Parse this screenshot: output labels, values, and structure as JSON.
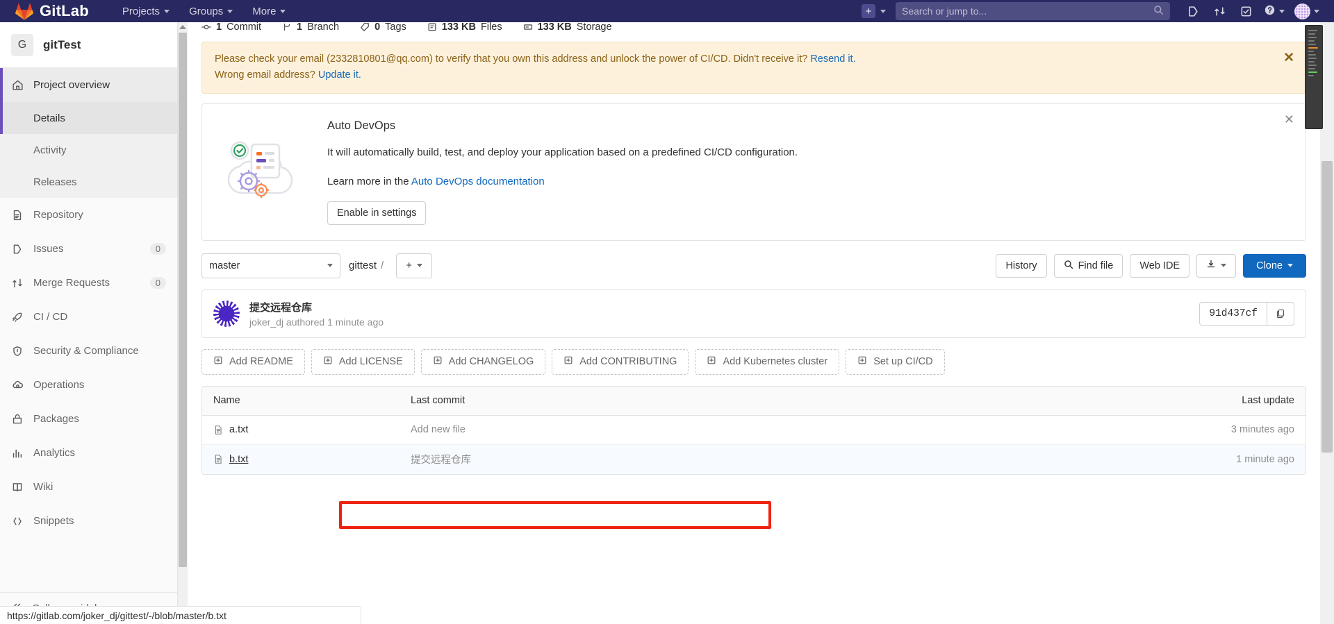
{
  "topnav": {
    "brand": "GitLab",
    "links": [
      {
        "label": "Projects",
        "icon": "chevron-down-icon"
      },
      {
        "label": "Groups",
        "icon": "chevron-down-icon"
      },
      {
        "label": "More",
        "icon": "chevron-down-icon"
      }
    ],
    "plus_label": "+",
    "search_placeholder": "Search or jump to...",
    "icons": [
      {
        "name": "issues-icon"
      },
      {
        "name": "merge-requests-icon"
      },
      {
        "name": "todos-icon"
      },
      {
        "name": "help-icon"
      },
      {
        "name": "user-avatar"
      }
    ]
  },
  "sidebar": {
    "project_initial": "G",
    "project_name": "gitTest",
    "overview": {
      "label": "Project overview",
      "icon": "home-icon"
    },
    "sub_items": [
      {
        "label": "Details",
        "current": true
      },
      {
        "label": "Activity",
        "current": false
      },
      {
        "label": "Releases",
        "current": false
      }
    ],
    "items": [
      {
        "label": "Repository",
        "icon": "document-icon",
        "badge": ""
      },
      {
        "label": "Issues",
        "icon": "issues-icon",
        "badge": "0"
      },
      {
        "label": "Merge Requests",
        "icon": "merge-requests-icon",
        "badge": "0"
      },
      {
        "label": "CI / CD",
        "icon": "rocket-icon",
        "badge": ""
      },
      {
        "label": "Security & Compliance",
        "icon": "shield-icon",
        "badge": ""
      },
      {
        "label": "Operations",
        "icon": "cloud-gear-icon",
        "badge": ""
      },
      {
        "label": "Packages",
        "icon": "package-icon",
        "badge": ""
      },
      {
        "label": "Analytics",
        "icon": "chart-icon",
        "badge": ""
      },
      {
        "label": "Wiki",
        "icon": "book-icon",
        "badge": ""
      },
      {
        "label": "Snippets",
        "icon": "snippet-icon",
        "badge": ""
      }
    ],
    "collapse_label": "Collapse sidebar"
  },
  "stats": [
    {
      "value": "1",
      "label": "Commit",
      "icon": "commit-icon"
    },
    {
      "value": "1",
      "label": "Branch",
      "icon": "branch-icon"
    },
    {
      "value": "0",
      "label": "Tags",
      "icon": "tag-icon"
    },
    {
      "value": "133 KB",
      "label": "Files",
      "icon": "files-icon"
    },
    {
      "value": "133 KB",
      "label": "Storage",
      "icon": "storage-icon"
    }
  ],
  "banner": {
    "text_before_email": "Please check your email (",
    "email": "2332810801@qq.com",
    "text_after_email": ") to verify that you own this address and unlock the power of CI/CD. Didn't receive it? ",
    "resend_link": "Resend it.",
    "line2_prefix": "Wrong email address? ",
    "update_link": "Update it.",
    "close_icon": "close-icon"
  },
  "auto_devops": {
    "title": "Auto DevOps",
    "description": "It will automatically build, test, and deploy your application based on a predefined CI/CD configuration.",
    "learn_prefix": "Learn more in the ",
    "learn_link": "Auto DevOps documentation",
    "button": "Enable in settings",
    "close_icon": "close-icon"
  },
  "toolbar": {
    "branch": "master",
    "breadcrumb_project": "gittest",
    "breadcrumb_sep": "/",
    "add_button": "+",
    "history": "History",
    "find_file": "Find file",
    "web_ide": "Web IDE",
    "download_icon": "download-icon",
    "clone": "Clone"
  },
  "commit": {
    "title": "提交远程仓库",
    "author": "joker_dj",
    "meta": "authored 1 minute ago",
    "sha": "91d437cf",
    "copy_icon": "copy-icon"
  },
  "add_buttons": [
    {
      "label": "Add README"
    },
    {
      "label": "Add LICENSE"
    },
    {
      "label": "Add CHANGELOG"
    },
    {
      "label": "Add CONTRIBUTING"
    },
    {
      "label": "Add Kubernetes cluster"
    },
    {
      "label": "Set up CI/CD"
    }
  ],
  "files": {
    "headers": {
      "name": "Name",
      "last_commit": "Last commit",
      "last_update": "Last update"
    },
    "rows": [
      {
        "name": "a.txt",
        "last_commit": "Add new file",
        "last_update": "3 minutes ago",
        "highlighted": false
      },
      {
        "name": "b.txt",
        "last_commit": "提交远程仓库",
        "last_update": "1 minute ago",
        "highlighted": true
      }
    ]
  },
  "status_bar": {
    "url": "https://gitlab.com/joker_dj/gittest/-/blob/master/b.txt"
  },
  "colors": {
    "nav_bg": "#292961",
    "accent_purple": "#6b4fbb",
    "primary_blue": "#1068bf",
    "link_blue": "#1b69b6",
    "banner_bg": "#fdf1dc",
    "banner_text": "#8a6116",
    "highlight_red": "#ee2211"
  }
}
